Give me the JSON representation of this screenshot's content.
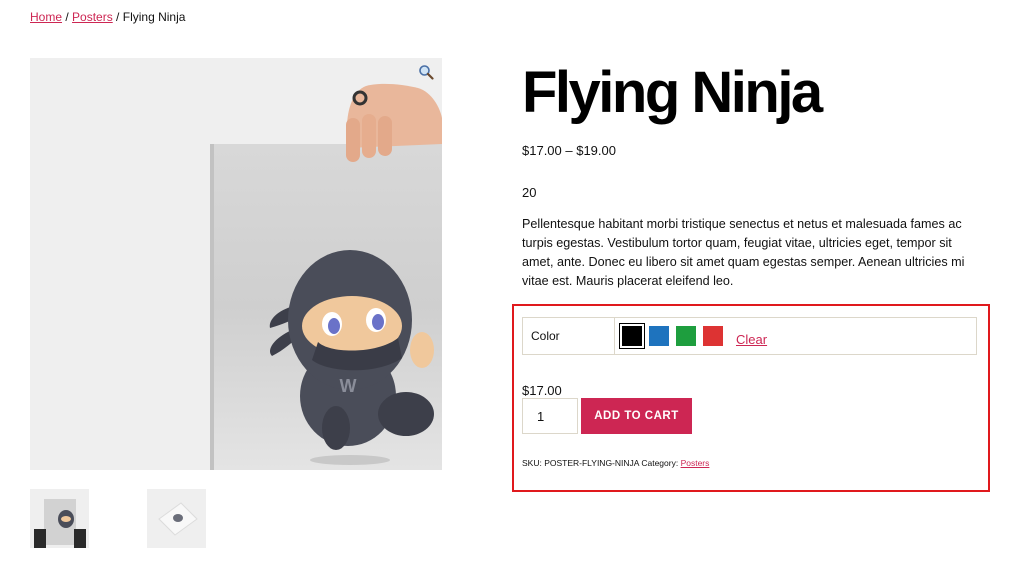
{
  "breadcrumb": {
    "home": "Home",
    "sep1": " / ",
    "category": "Posters",
    "sep2": " / ",
    "current": "Flying Ninja"
  },
  "product": {
    "title": "Flying Ninja",
    "price_range": "$17.00 – $19.00",
    "stock_value": "20",
    "description": "Pellentesque habitant morbi tristique senectus et netus et malesuada fames ac turpis egestas. Vestibulum tortor quam, feugiat vitae, ultricies eget, tempor sit amet, ante. Donec eu libero sit amet quam egestas semper. Aenean ultricies mi vitae est. Mauris placerat eleifend leo."
  },
  "variations": {
    "label": "Color",
    "swatches": [
      {
        "name": "black",
        "color": "#000000",
        "selected": true
      },
      {
        "name": "blue",
        "color": "#1e73be",
        "selected": false
      },
      {
        "name": "green",
        "color": "#1e9e3e",
        "selected": false
      },
      {
        "name": "red",
        "color": "#dd3333",
        "selected": false
      }
    ],
    "clear_label": "Clear"
  },
  "cart": {
    "variation_price": "$17.00",
    "quantity": "1",
    "add_to_cart_label": "ADD TO CART"
  },
  "meta": {
    "sku_label": "SKU: ",
    "sku_value": "POSTER-FLYING-NINJA",
    "category_label": " Category: ",
    "category_value": "Posters"
  },
  "icons": {
    "zoom": "magnifier-icon"
  },
  "colors": {
    "accent": "#cd2653",
    "highlight_border": "#e0191d"
  }
}
